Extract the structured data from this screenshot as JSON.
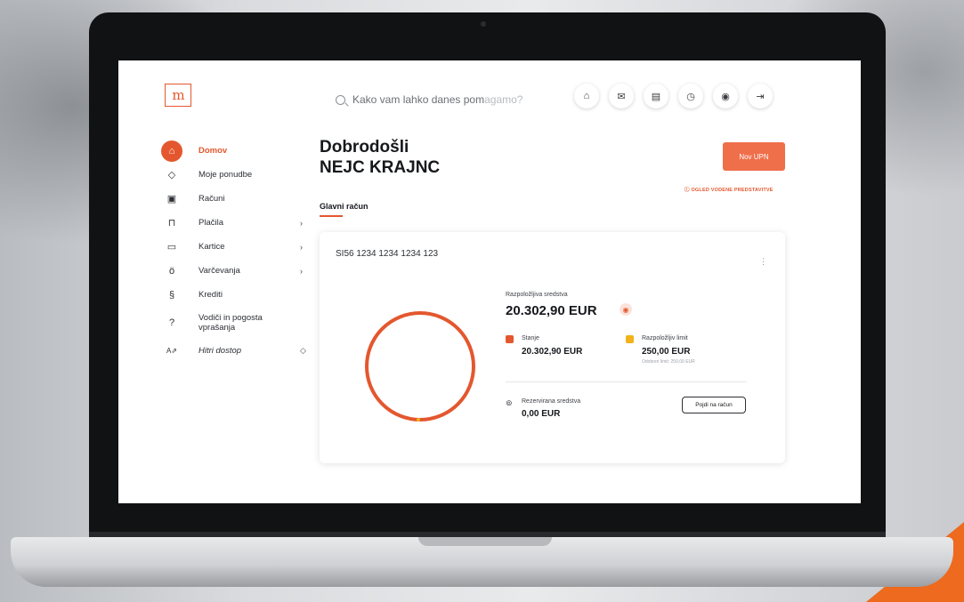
{
  "colors": {
    "accent": "#e4572e",
    "button": "#ef6f4a"
  },
  "header": {
    "logo_text": "m",
    "search_placeholder_part1": "Kako vam lahko danes pom",
    "search_placeholder_part2": "agamo?",
    "icons": [
      "home-alert-icon",
      "mail-icon",
      "document-icon",
      "timer-icon",
      "user-icon",
      "logout-icon"
    ]
  },
  "sidebar": {
    "items": [
      {
        "label": "Domov",
        "icon": "home-icon",
        "active": true
      },
      {
        "label": "Moje ponudbe",
        "icon": "tag-icon"
      },
      {
        "label": "Računi",
        "icon": "wallet-icon"
      },
      {
        "label": "Plačila",
        "icon": "payment-icon",
        "chevron": "›"
      },
      {
        "label": "Kartice",
        "icon": "card-icon",
        "chevron": "›"
      },
      {
        "label": "Varčevanja",
        "icon": "savings-icon",
        "chevron": "›"
      },
      {
        "label": "Krediti",
        "icon": "credit-icon"
      },
      {
        "label": "Vodiči in pogosta vprašanja",
        "icon": "help-icon"
      },
      {
        "label": "Hitri dostop",
        "icon": "quick-access-icon",
        "chevron": "◇"
      }
    ]
  },
  "main": {
    "welcome_line1": "Dobrodošli",
    "welcome_line2": "NEJC KRAJNC",
    "upn_button": "Nov UPN",
    "guide_link": "OGLED VODENE PREDSTAVITVE",
    "tab_label": "Glavni račun",
    "account": {
      "iban": "SI56 1234 1234 1234 123",
      "available_label": "Razpoložljiva sredstva",
      "available_amount": "20.302,90 EUR",
      "balance_label": "Stanje",
      "balance_amount": "20.302,90 EUR",
      "limit_label": "Razpoložljiv limit",
      "limit_amount": "250,00 EUR",
      "approved_limit": "Odobren limit: 250,00 EUR",
      "reserved_label": "Rezervirana sredstva",
      "reserved_amount": "0,00 EUR",
      "goto_button": "Pojdi na račun"
    }
  }
}
